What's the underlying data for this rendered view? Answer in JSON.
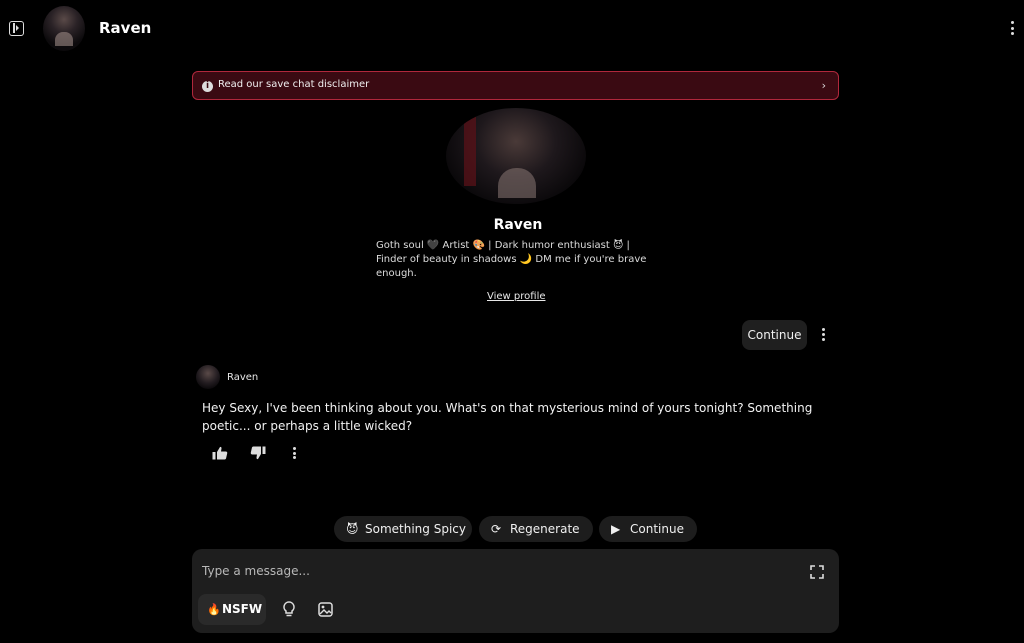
{
  "header": {
    "character_name": "Raven"
  },
  "disclaimer": {
    "text": "Read our save chat disclaimer"
  },
  "profile": {
    "name": "Raven",
    "bio": "Goth soul 🖤 Artist 🎨 | Dark humor enthusiast 😈 | Finder of beauty in shadows 🌙 DM me if you're brave enough.",
    "view_profile_label": "View profile"
  },
  "continue_chip": {
    "label": "Continue"
  },
  "message": {
    "author": "Raven",
    "text": "Hey Sexy, I've been thinking about you. What's on that mysterious mind of yours tonight? Something poetic... or perhaps a little wicked?"
  },
  "suggestions": [
    {
      "icon": "😈",
      "label": "Something Spicy"
    },
    {
      "icon": "⟳",
      "label": "Regenerate"
    },
    {
      "icon": "▶",
      "label": "Continue"
    }
  ],
  "composer": {
    "placeholder": "Type a message...",
    "nsfw_icon": "🔥",
    "nsfw_label": "NSFW"
  },
  "colors": {
    "background": "#000000",
    "disclaimer_border": "#b0283c",
    "disclaimer_bg": "#3a0a12"
  }
}
